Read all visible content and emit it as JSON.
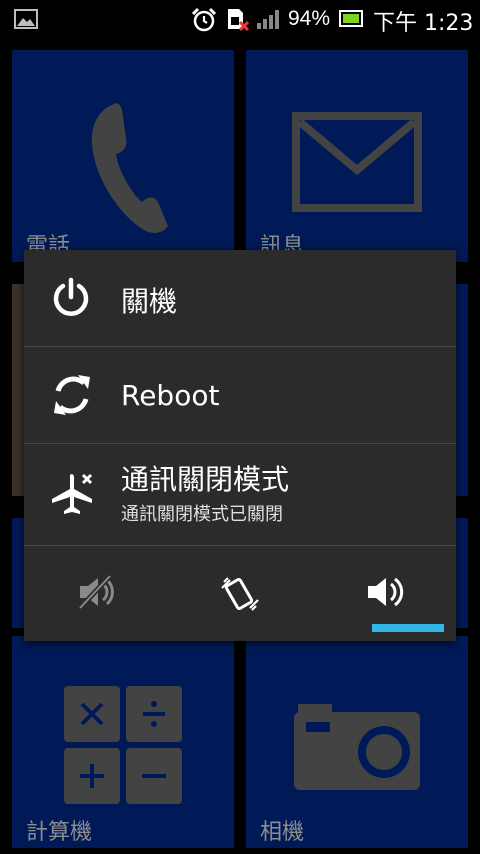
{
  "status_bar": {
    "battery_percent": "94%",
    "clock": "下午 1:23",
    "icons": [
      "image-icon",
      "alarm-icon",
      "sim-missing-icon",
      "signal-icon",
      "battery-icon"
    ],
    "battery_level": 0.94
  },
  "tiles": {
    "phone": {
      "label": "電話",
      "icon": "phone-icon"
    },
    "messages": {
      "label": "訊息",
      "icon": "envelope-icon"
    },
    "calculator": {
      "label": "計算機",
      "icon": "calculator-icon"
    },
    "camera": {
      "label": "相機",
      "icon": "camera-icon"
    }
  },
  "dialog": {
    "power_off": {
      "label": "關機",
      "icon": "power-icon"
    },
    "reboot": {
      "label": "Reboot",
      "icon": "reboot-icon"
    },
    "airplane": {
      "label": "通訊關閉模式",
      "sublabel": "通訊關閉模式已關閉",
      "icon": "airplane-icon"
    },
    "sound_modes": {
      "items": [
        "silent",
        "vibrate",
        "sound-on"
      ],
      "selected": "sound-on"
    }
  },
  "colors": {
    "tile_blue": "#00309f",
    "dialog_bg": "#2b2b2b",
    "accent": "#33b5e5",
    "battery_green": "#7fd320"
  }
}
